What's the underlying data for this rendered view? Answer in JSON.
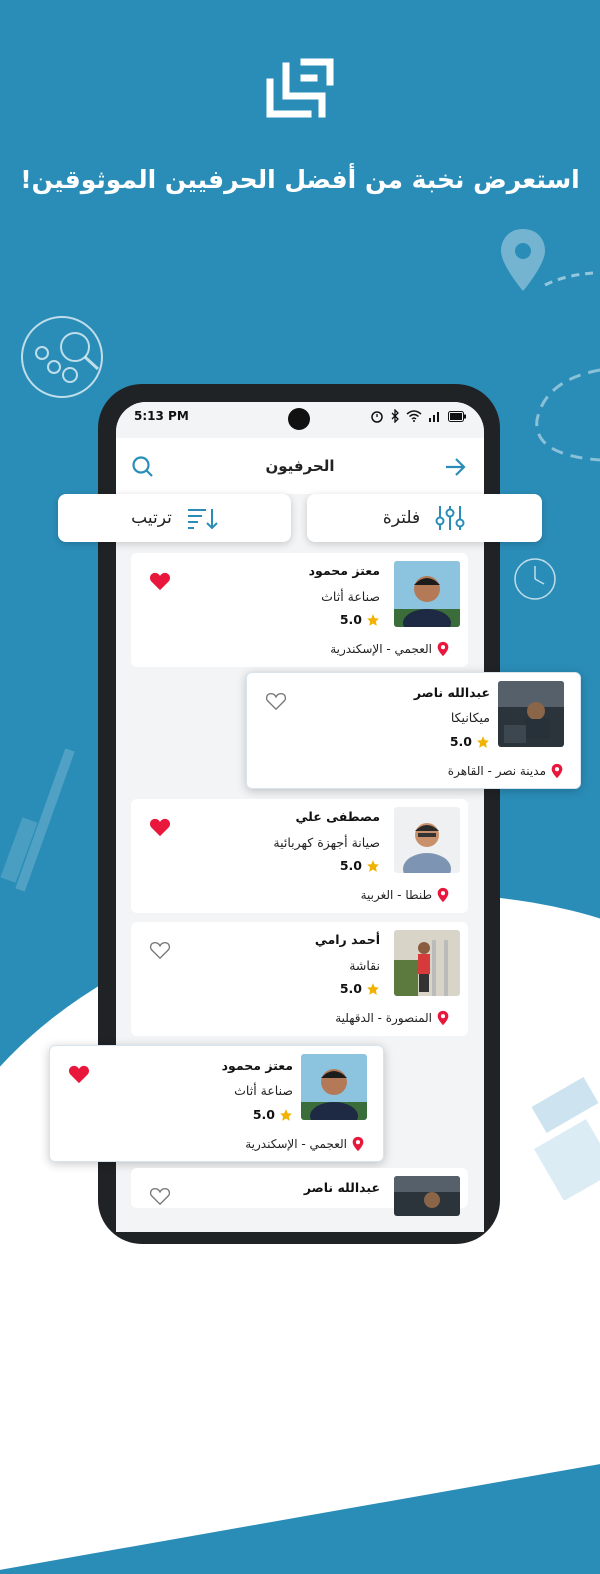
{
  "headline": "استعرض نخبة من أفضل الحرفيين الموثوقين!",
  "status_bar": {
    "time": "5:13 PM"
  },
  "app_bar": {
    "title": "الحرفيون"
  },
  "filter_label": "فلترة",
  "sort_label": "ترتيب",
  "colors": {
    "brand": "#2a8db8",
    "heart": "#e8173b",
    "pin": "#e8173b",
    "star": "#f2b200"
  },
  "cards": [
    {
      "name": "معتز محمود",
      "craft": "صناعة أثاث",
      "rating": "5.0",
      "location": "العجمي - الإسكندرية",
      "favorited": true
    },
    {
      "name": "عبدالله ناصر",
      "craft": "ميكانيكا",
      "rating": "5.0",
      "location": "مدينة نصر - القاهرة",
      "favorited": false
    },
    {
      "name": "مصطفى علي",
      "craft": "صيانة أجهزة كهربائية",
      "rating": "5.0",
      "location": "طنطا - الغربية",
      "favorited": true
    },
    {
      "name": "أحمد رامي",
      "craft": "نقاشة",
      "rating": "5.0",
      "location": "المنصورة - الدقهلية",
      "favorited": false
    },
    {
      "name": "معتز محمود",
      "craft": "صناعة أثاث",
      "rating": "5.0",
      "location": "العجمي - الإسكندرية",
      "favorited": true
    },
    {
      "name": "عبدالله ناصر",
      "favorited": false
    }
  ]
}
